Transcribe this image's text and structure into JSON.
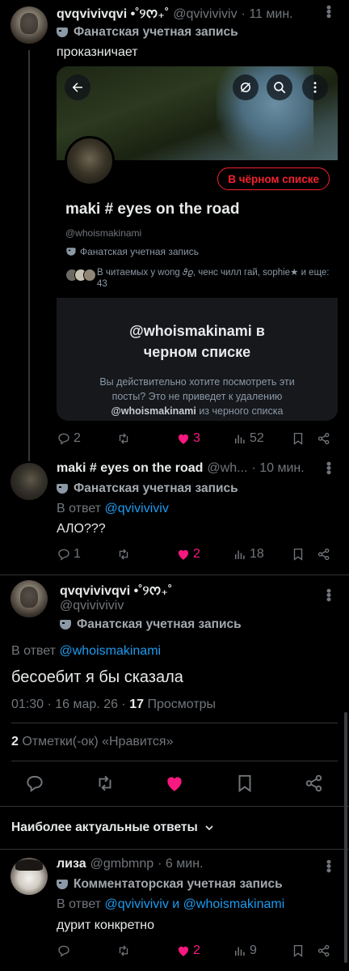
{
  "tweet1": {
    "display_name": "qvqvivivqvi •˚୨ᰔ₊˚",
    "handle": "@qvivivivіv",
    "time": "· 11 мин.",
    "badge": "Фанатская учетная запись",
    "text": "проказничает",
    "card": {
      "blocked_label": "В чёрном списке",
      "name": "maki # eyes on the road",
      "handle": "@whoismakinami",
      "badge": "Фанатская учетная запись",
      "followers_text": "В читаемых у wong 𝜗𝜚, ченс чилл гай, sophie★ и еще: 43",
      "panel_title": "@whoismakinami в черном списке",
      "panel_text_1": "Вы действительно хотите посмотреть эти посты? Это не приведет к удалению",
      "panel_handle": "@whoismakinami",
      "panel_text_2": "из черного списка"
    },
    "counts": {
      "replies": "2",
      "retweets": "",
      "likes": "3",
      "views": "52"
    }
  },
  "tweet2": {
    "display_name": "maki # eyes on the road",
    "handle": "@wh...",
    "time": "· 10 мин.",
    "badge": "Фанатская учетная запись",
    "reply_prefix": "В ответ",
    "reply_handle": "@qvivivivіv",
    "text": "АЛО???",
    "counts": {
      "replies": "1",
      "retweets": "",
      "likes": "2",
      "views": "18"
    }
  },
  "main": {
    "display_name": "qvqvivivqvi •˚୨ᰔ₊˚",
    "handle": "@qvivivivіv",
    "badge": "Фанатская учетная запись",
    "reply_prefix": "В ответ",
    "reply_handle": "@whoismakinami",
    "text": "бесоебит я бы сказала",
    "time": "01:30 · 16 мар. 26 ·",
    "views_count": "17",
    "views_label": "Просмотры",
    "likes_count": "2",
    "likes_label": "Отметки(-ок) «Нравится»"
  },
  "sort_label": "Наиболее актуальные ответы",
  "reply": {
    "display_name": "лиза",
    "handle": "@gmbmnp",
    "time": "· 6 мин.",
    "badge": "Комментаторская учетная запись",
    "reply_prefix": "В ответ",
    "reply_handle_1": "@qvivivivіv",
    "reply_and": "и",
    "reply_handle_2": "@whoismakinami",
    "text": "дурит конкретно",
    "counts": {
      "replies": "",
      "retweets": "",
      "likes": "2",
      "views": "9"
    }
  },
  "colors": {
    "like": "#f91880",
    "link": "#1d9bf0",
    "muted": "#71767b",
    "blocked": "#f4212e"
  }
}
